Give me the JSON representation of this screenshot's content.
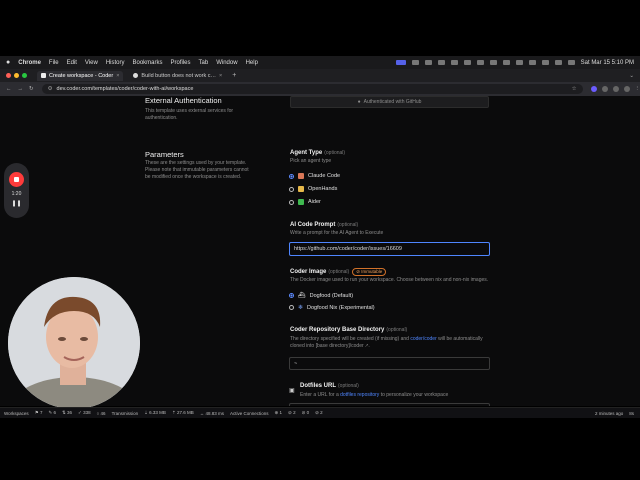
{
  "menubar": {
    "apple": "",
    "items": [
      "Chrome",
      "File",
      "Edit",
      "View",
      "History",
      "Bookmarks",
      "Profiles",
      "Tab",
      "Window",
      "Help"
    ],
    "datetime": "Sat Mar 15  5:10 PM"
  },
  "tabs": [
    {
      "label": "Create workspace - Coder",
      "active": true
    },
    {
      "label": "Build button does not work c…",
      "active": false
    }
  ],
  "new_tab": "+",
  "url": "dev.coder.com/templates/coder/coder-with-ai/workspace",
  "recorder": {
    "time": "1:20",
    "pause": "❚❚"
  },
  "external_auth": {
    "title": "External Authentication",
    "desc": "This template uses external services for authentication.",
    "button": "Authenticated with GitHub"
  },
  "parameters": {
    "title": "Parameters",
    "desc": "These are the settings used by your template. Please note that immutable parameters cannot be modified once the workspace is created."
  },
  "agent_type": {
    "label": "Agent Type",
    "optional": "(optional)",
    "desc": "Pick an agent type",
    "options": [
      {
        "label": "Claude Code",
        "selected": true,
        "icon_color": "#d97757"
      },
      {
        "label": "OpenHands",
        "selected": false,
        "icon_color": "#e6b84a"
      },
      {
        "label": "Aider",
        "selected": false,
        "icon_color": "#3fb950"
      }
    ]
  },
  "ai_prompt": {
    "label": "AI Code Prompt",
    "optional": "(optional)",
    "desc": "Write a prompt for the AI Agent to Execute",
    "value": "https://github.com/coder/coder/issues/16609"
  },
  "coder_image": {
    "label": "Coder Image",
    "optional": "(optional)",
    "badge": "Immutable",
    "desc": "The Docker image used to run your workspace. Choose between nix and non-nix images.",
    "options": [
      {
        "label": "Dogfood (Default)",
        "selected": true
      },
      {
        "label": "Dogfood Nix (Experimental)",
        "selected": false
      }
    ]
  },
  "repo_dir": {
    "label": "Coder Repository Base Directory",
    "optional": "(optional)",
    "desc1": "The directory specified will be created (if missing) and",
    "desc_link": "coder/coder",
    "desc2": "will be automatically cloned into [base directory]/coder 🡕.",
    "value": "~"
  },
  "dotfiles": {
    "label": "Dotfiles URL",
    "optional": "(optional)",
    "desc1": "Enter a URL for a",
    "desc_link": "dotfiles repository",
    "desc2": "to personalize your workspace"
  },
  "statusbar": {
    "left": [
      "Workspaces",
      "⚑ 7",
      "✎ 6",
      "⇅ 36",
      "✓ 338",
      "○ 46",
      "Transmission",
      "⇣ 6.33 MB",
      "⇡ 27.6 MB",
      "↔ 48.83 ms",
      "Active Connections",
      "⊕ 1",
      "⊘ 2",
      "⊘ 0",
      "⊘ 2"
    ],
    "right": [
      "2 minutes ago",
      "8s"
    ]
  }
}
